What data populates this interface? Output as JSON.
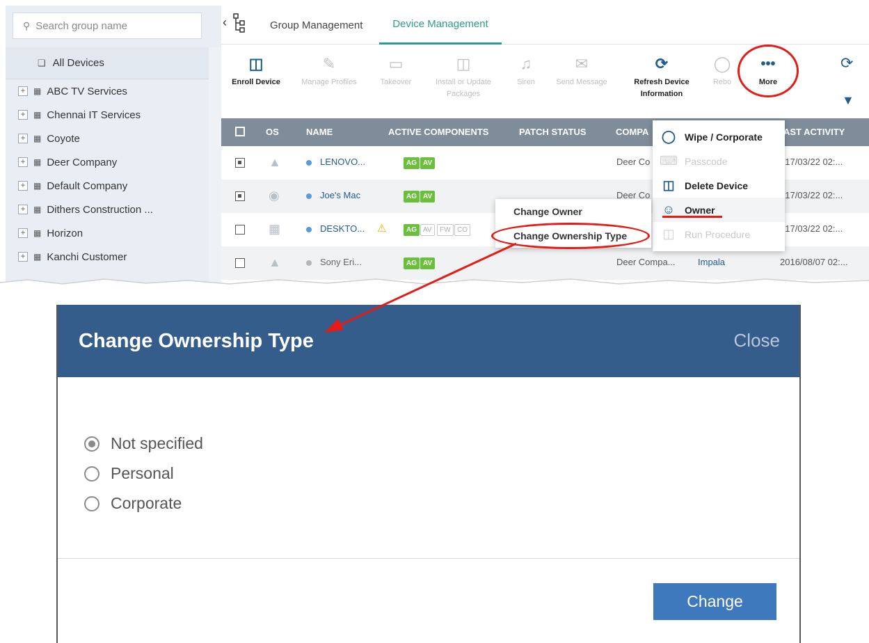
{
  "sidebar": {
    "search_placeholder": "Search group name",
    "all_devices": "All Devices",
    "groups": [
      "ABC TV Services",
      "Chennai IT Services",
      "Coyote",
      "Deer Company",
      "Default Company",
      "Dithers Construction ...",
      "Horizon",
      "Kanchi Customer"
    ]
  },
  "tabs": {
    "group": "Group Management",
    "device": "Device Management"
  },
  "toolbar": {
    "enroll": "Enroll Device",
    "manage_profiles": "Manage Profiles",
    "takeover": "Takeover",
    "install_1": "Install or Update",
    "install_2": "Packages",
    "siren": "Siren",
    "send_message": "Send Message",
    "refresh_1": "Refresh Device",
    "refresh_2": "Information",
    "reboot": "Rebo",
    "more": "More"
  },
  "table": {
    "headers": {
      "os": "OS",
      "name": "NAME",
      "active": "ACTIVE COMPONENTS",
      "patch": "PATCH STATUS",
      "company": "COMPA",
      "last": "AST ACTIVITY"
    },
    "rows": [
      {
        "name": "LENOVO...",
        "badges": [
          "AG",
          "AV"
        ],
        "company": "Deer Co",
        "owner": "",
        "last": "017/03/22 02:..."
      },
      {
        "name": "Joe's Mac",
        "badges": [
          "AG",
          "AV"
        ],
        "company": "Deer Co",
        "owner": "",
        "last": "017/03/22 02:..."
      },
      {
        "name": "DESKTO...",
        "badges": [
          "AG",
          "AV",
          "FW",
          "CO"
        ],
        "company": "",
        "owner": "",
        "last": "017/03/22 02:..."
      },
      {
        "name": "Sony Eri...",
        "badges": [
          "AG",
          "AV"
        ],
        "company": "Deer Compa...",
        "owner": "Impala",
        "last": "2016/08/07 02:..."
      }
    ]
  },
  "more_menu": {
    "wipe": "Wipe / Corporate",
    "passcode": "Passcode",
    "delete": "Delete Device",
    "owner": "Owner",
    "run": "Run Procedure"
  },
  "owner_submenu": {
    "change_owner": "Change Owner",
    "change_type": "Change Ownership Type"
  },
  "dialog": {
    "title": "Change Ownership Type",
    "close": "Close",
    "options": [
      "Not specified",
      "Personal",
      "Corporate"
    ],
    "selected": "Not specified",
    "submit": "Change"
  },
  "colors": {
    "accent": "#2a9d8f",
    "header": "#345d8c",
    "annotation": "#e41b17",
    "button": "#3e79bd"
  }
}
